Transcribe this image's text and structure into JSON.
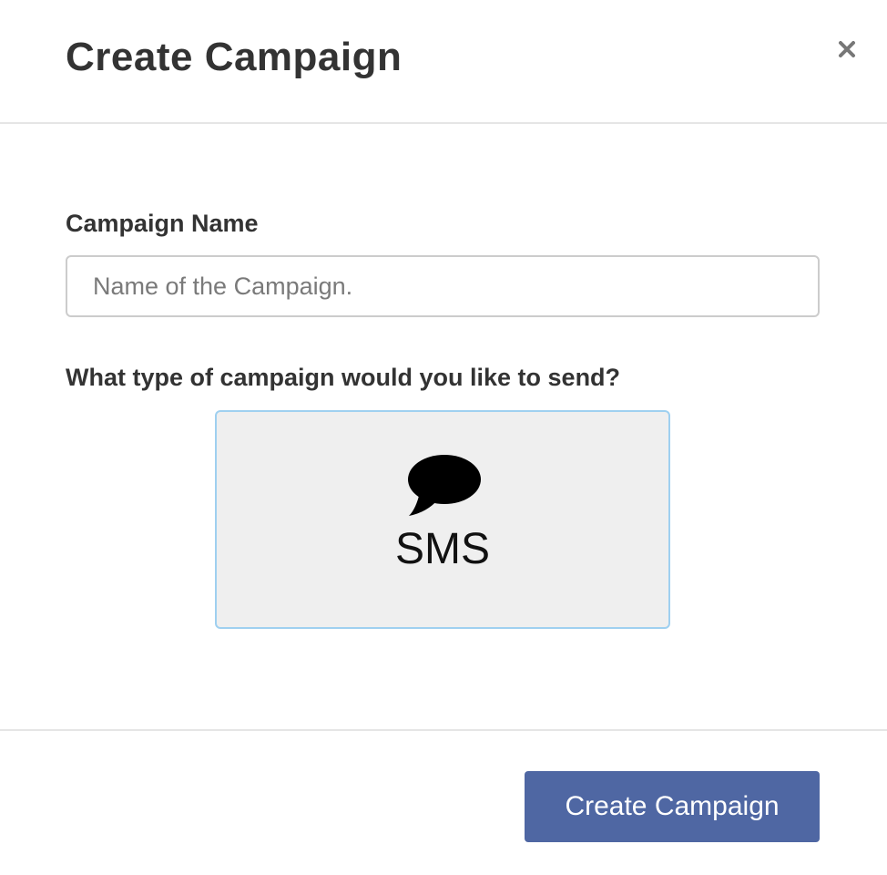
{
  "dialog": {
    "title": "Create Campaign",
    "close_icon": "close-icon"
  },
  "form": {
    "name_label": "Campaign Name",
    "name_value": "",
    "name_placeholder": "Name of the Campaign.",
    "type_question": "What type of campaign would you like to send?",
    "type_options": [
      {
        "label": "SMS",
        "icon": "chat-bubble-icon"
      }
    ]
  },
  "footer": {
    "submit_label": "Create Campaign"
  },
  "colors": {
    "primary_button": "#4f67a3",
    "option_border": "#9fd0f0",
    "option_background": "#efefef",
    "divider": "#e5e5e5"
  }
}
